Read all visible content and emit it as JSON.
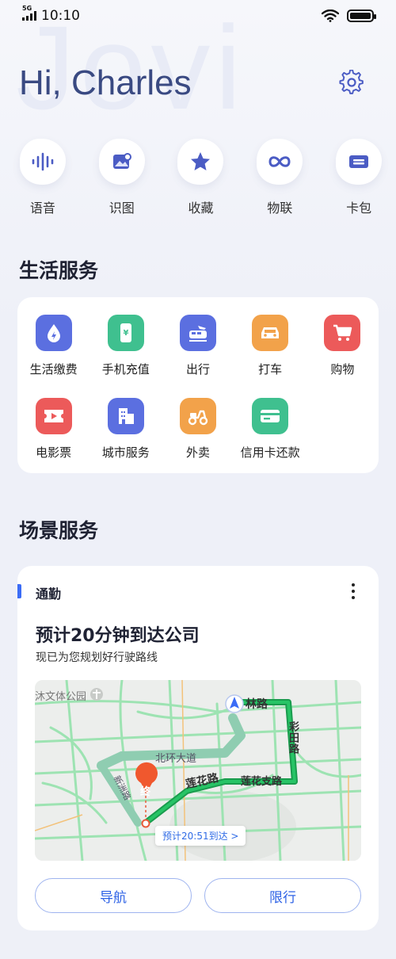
{
  "status_bar": {
    "network": "5G",
    "time": "10:10"
  },
  "header": {
    "watermark": "Jovi",
    "greeting": "Hi, Charles"
  },
  "quick_actions": [
    {
      "label": "语音",
      "icon": "voice-wave-icon",
      "color": "#4b5cc4"
    },
    {
      "label": "识图",
      "icon": "image-recognition-icon",
      "color": "#4b5cc4"
    },
    {
      "label": "收藏",
      "icon": "star-icon",
      "color": "#4b5cc4"
    },
    {
      "label": "物联",
      "icon": "infinity-icon",
      "color": "#4b5cc4"
    },
    {
      "label": "卡包",
      "icon": "card-wallet-icon",
      "color": "#4b5cc4"
    }
  ],
  "life_services": {
    "title": "生活服务",
    "items": [
      {
        "label": "生活缴费",
        "icon": "utility-drop-icon",
        "color": "#5b6fe0"
      },
      {
        "label": "手机充值",
        "icon": "phone-recharge-icon",
        "color": "#3fc08f"
      },
      {
        "label": "出行",
        "icon": "train-plane-icon",
        "color": "#5b6fe0"
      },
      {
        "label": "打车",
        "icon": "taxi-icon",
        "color": "#f2a24a"
      },
      {
        "label": "购物",
        "icon": "shopping-cart-icon",
        "color": "#ec5a5a"
      },
      {
        "label": "电影票",
        "icon": "movie-ticket-icon",
        "color": "#ec5a5a"
      },
      {
        "label": "城市服务",
        "icon": "city-building-icon",
        "color": "#5b6fe0"
      },
      {
        "label": "外卖",
        "icon": "scooter-icon",
        "color": "#f2a24a"
      },
      {
        "label": "信用卡还款",
        "icon": "credit-card-icon",
        "color": "#3fc08f"
      }
    ]
  },
  "scene_services": {
    "title": "场景服务",
    "card": {
      "tag": "通勤",
      "headline": "预计20分钟到达公司",
      "subtitle": "现已为您规划好行驶路线",
      "map": {
        "park_label": "沐文体公园",
        "road_labels": [
          "林路",
          "彩田路",
          "北环大道",
          "莲花路",
          "莲花支路",
          "新洲路"
        ],
        "destination_marker": "终",
        "eta_pill": "预计20:51到达 >"
      },
      "buttons": {
        "navigate": "导航",
        "restriction": "限行"
      }
    }
  }
}
